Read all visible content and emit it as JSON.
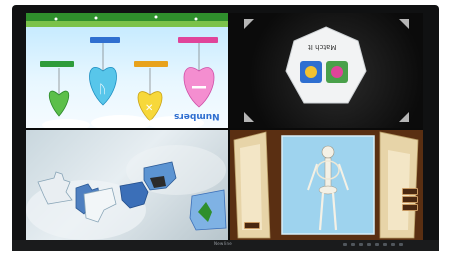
{
  "device": {
    "brand": "Newline"
  },
  "panels": {
    "top_left": {
      "app": "Numbers",
      "title": "Numbers"
    },
    "top_right": {
      "app": "Match It",
      "title": "Match It"
    },
    "bottom_left": {
      "app": "Puzzle"
    },
    "bottom_right": {
      "app": "Skeleton"
    }
  },
  "colors": {
    "bezel": "#101112",
    "bg": "#ffffff"
  }
}
